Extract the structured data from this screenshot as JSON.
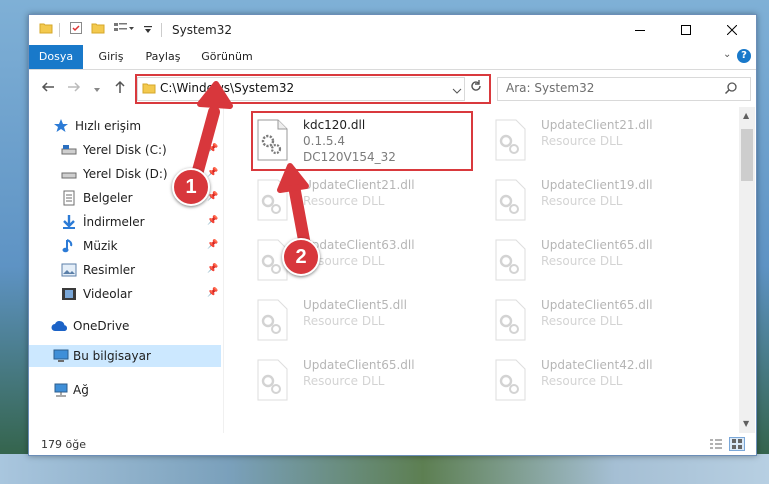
{
  "window": {
    "title": "System32",
    "controls": {
      "minimize": "minimize-icon",
      "maximize": "maximize-icon",
      "close": "close-icon"
    }
  },
  "ribbon": {
    "tabs": [
      {
        "label": "Dosya",
        "active": true
      },
      {
        "label": "Giriş",
        "active": false
      },
      {
        "label": "Paylaş",
        "active": false
      },
      {
        "label": "Görünüm",
        "active": false
      }
    ]
  },
  "address": {
    "path": "C:\\Windows\\System32"
  },
  "search": {
    "placeholder": "Ara: System32"
  },
  "sidebar": {
    "items": [
      {
        "label": "Hızlı erişim",
        "icon": "star-icon",
        "pinned": false
      },
      {
        "label": "Yerel Disk (C:)",
        "icon": "drive-icon",
        "pinned": true
      },
      {
        "label": "Yerel Disk (D:)",
        "icon": "drive-icon",
        "pinned": true
      },
      {
        "label": "Belgeler",
        "icon": "documents-icon",
        "pinned": true
      },
      {
        "label": "İndirmeler",
        "icon": "download-icon",
        "pinned": true
      },
      {
        "label": "Müzik",
        "icon": "music-icon",
        "pinned": true
      },
      {
        "label": "Resimler",
        "icon": "pictures-icon",
        "pinned": true
      },
      {
        "label": "Videolar",
        "icon": "videos-icon",
        "pinned": true
      },
      {
        "label": "OneDrive",
        "icon": "cloud-icon",
        "pinned": false
      },
      {
        "label": "Bu bilgisayar",
        "icon": "computer-icon",
        "pinned": false,
        "selected": true
      },
      {
        "label": "Ağ",
        "icon": "network-icon",
        "pinned": false
      }
    ]
  },
  "files": [
    {
      "name": "kdc120.dll",
      "line2": "0.1.5.4",
      "line3": "DC120V154_32",
      "highlighted": true
    },
    {
      "name": "UpdateClient21.dll",
      "line2": "Resource DLL"
    },
    {
      "name": "UpdateClient21.dll",
      "line2": "Resource DLL"
    },
    {
      "name": "UpdateClient19.dll",
      "line2": "Resource DLL"
    },
    {
      "name": "UpdateClient63.dll",
      "line2": "Resource DLL"
    },
    {
      "name": "UpdateClient65.dll",
      "line2": "Resource DLL"
    },
    {
      "name": "UpdateClient5.dll",
      "line2": "Resource DLL"
    },
    {
      "name": "UpdateClient65.dll",
      "line2": "Resource DLL"
    },
    {
      "name": "UpdateClient65.dll",
      "line2": "Resource DLL"
    },
    {
      "name": "UpdateClient42.dll",
      "line2": "Resource DLL"
    }
  ],
  "status": {
    "item_count": "179 öğe"
  },
  "annotations": {
    "step1": "1",
    "step2": "2",
    "color": "#d8373c"
  }
}
